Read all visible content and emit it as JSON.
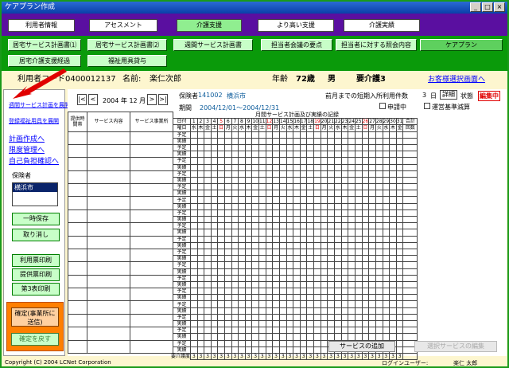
{
  "window": {
    "title": "ケアプラン作成"
  },
  "menu": [
    "利用者情報",
    "アセスメント",
    "介護支援",
    "より高い支援",
    "介護実績"
  ],
  "sub": [
    "居宅サービス計画書⑴",
    "居宅サービス計画書⑵",
    "週間サービス計画書",
    "担当者会議の要点",
    "担当者に対する照会内容",
    "ケアプラン",
    "居宅介護支援経過",
    "福祉用具貸与"
  ],
  "user": {
    "code_label": "利用者コード",
    "code": "0400012137",
    "name_label": "名前:",
    "name": "楽仁次郎",
    "age_label": "年齢",
    "age": "72歳",
    "sex": "男",
    "level": "要介護3",
    "select_link": "お客様選択画面へ"
  },
  "left": {
    "links": [
      "週間サービス計画を展開",
      "登録福祉用具を展開",
      "計画作成へ",
      "限度管理へ",
      "自己負担確認へ"
    ],
    "insurer_label": "保険者",
    "insurer_value": "横浜市",
    "buttons": [
      "一時保存",
      "取り消し",
      "利用票印刷",
      "提供票印刷",
      "第3表印刷"
    ],
    "confirm": "確定(事業所に送信)",
    "revert": "確定を戻す"
  },
  "main": {
    "month": "2004 年 12 月",
    "insurer_label": "保険者",
    "insurer_no": "141002",
    "insurer_city": "横浜市",
    "period_label": "期間",
    "period": "2004/12/01〜2004/12/31",
    "short_stay": "前月までの短期入所利用件数",
    "short_stay_count": "3",
    "short_stay_unit": "日",
    "detail": "詳細",
    "status_label": "状態",
    "status": "編集中",
    "applying": "申請中",
    "standard": "運営基準減算",
    "grid_title": "月間サービス計画及び実績の記録",
    "col_time": "提供時間帯",
    "col_service": "サービス内容",
    "col_office": "サービス事業所",
    "col_date": "日付",
    "col_dow": "曜日",
    "col_total": "合計",
    "col_count": "回数",
    "row_plan": "予定",
    "row_actual": "実績",
    "care_level": "要介護度",
    "care_val": "3",
    "add": "サービスの追加",
    "edit": "選択サービスの編集"
  },
  "days": [
    "1",
    "2",
    "3",
    "4",
    "5",
    "6",
    "7",
    "8",
    "9",
    "10",
    "11",
    "12",
    "13",
    "14",
    "15",
    "16",
    "17",
    "18",
    "19",
    "20",
    "21",
    "22",
    "23",
    "24",
    "25",
    "26",
    "27",
    "28",
    "29",
    "30",
    "31"
  ],
  "dows": [
    "水",
    "木",
    "金",
    "土",
    "日",
    "月",
    "火",
    "水",
    "木",
    "金",
    "土",
    "日",
    "月",
    "火",
    "水",
    "木",
    "金",
    "土",
    "日",
    "月",
    "火",
    "水",
    "木",
    "金",
    "土",
    "日",
    "月",
    "火",
    "水",
    "木",
    "金"
  ],
  "footer": {
    "copyright": "Copyright (C) 2004 LCNet Corporation",
    "login_label": "ログインユーザー:",
    "login": "楽仁 太郎"
  },
  "colors": {
    "accent_red": "#e00000"
  }
}
